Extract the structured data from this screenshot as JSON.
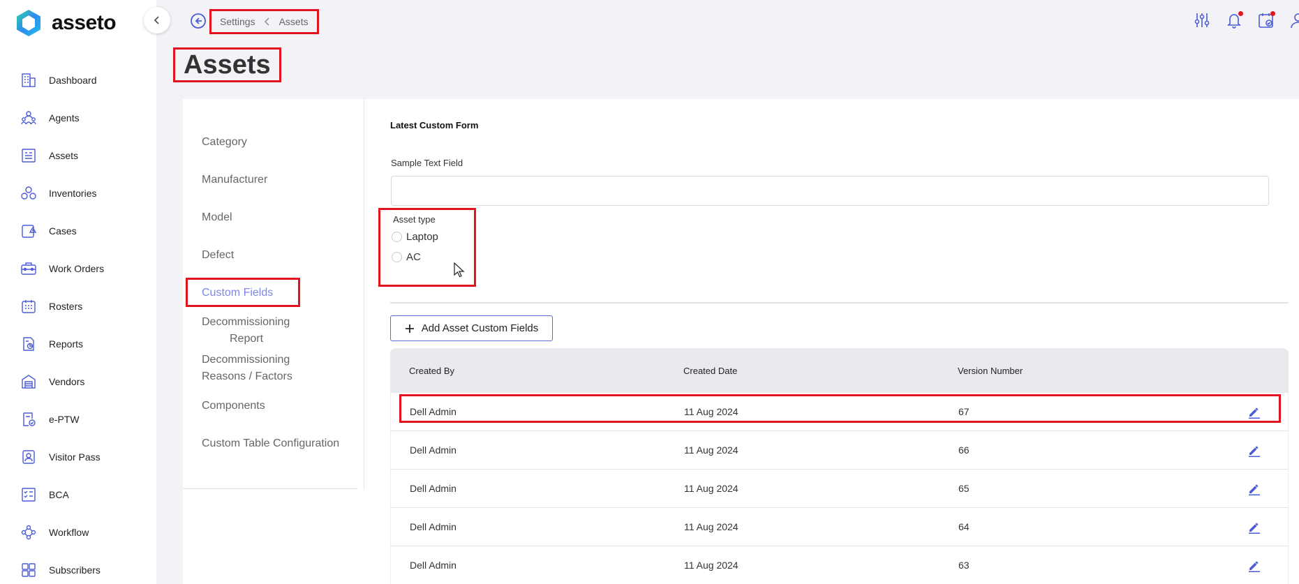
{
  "app": {
    "name": "asseto"
  },
  "breadcrumb": {
    "parent": "Settings",
    "current": "Assets"
  },
  "page": {
    "title": "Assets"
  },
  "sidebar": {
    "items": [
      {
        "label": "Dashboard",
        "icon": "dashboard-icon"
      },
      {
        "label": "Agents",
        "icon": "agents-icon"
      },
      {
        "label": "Assets",
        "icon": "assets-icon"
      },
      {
        "label": "Inventories",
        "icon": "inventories-icon"
      },
      {
        "label": "Cases",
        "icon": "cases-icon"
      },
      {
        "label": "Work Orders",
        "icon": "work-orders-icon"
      },
      {
        "label": "Rosters",
        "icon": "rosters-icon"
      },
      {
        "label": "Reports",
        "icon": "reports-icon"
      },
      {
        "label": "Vendors",
        "icon": "vendors-icon"
      },
      {
        "label": "e-PTW",
        "icon": "eptw-icon"
      },
      {
        "label": "Visitor Pass",
        "icon": "visitor-pass-icon"
      },
      {
        "label": "BCA",
        "icon": "bca-icon"
      },
      {
        "label": "Workflow",
        "icon": "workflow-icon"
      },
      {
        "label": "Subscribers",
        "icon": "subscribers-icon"
      }
    ]
  },
  "settings_menu": {
    "items": [
      "Category",
      "Manufacturer",
      "Model",
      "Defect",
      "Custom Fields",
      "Decommissioning",
      "Report",
      "Decommissioning",
      "Reasons / Factors",
      "Components",
      "Custom Table Configuration"
    ],
    "active": "Custom Fields"
  },
  "form": {
    "title": "Latest Custom Form",
    "text_field_label": "Sample Text Field",
    "text_field_value": "",
    "radio_label": "Asset type",
    "radio_options": [
      "Laptop",
      "AC"
    ]
  },
  "add_button_label": "Add Asset Custom Fields",
  "table": {
    "headers": [
      "Created By",
      "Created Date",
      "Version Number"
    ],
    "rows": [
      [
        "Dell Admin",
        "11 Aug 2024",
        "67"
      ],
      [
        "Dell Admin",
        "11 Aug 2024",
        "66"
      ],
      [
        "Dell Admin",
        "11 Aug 2024",
        "65"
      ],
      [
        "Dell Admin",
        "11 Aug 2024",
        "64"
      ],
      [
        "Dell Admin",
        "11 Aug 2024",
        "63"
      ]
    ]
  },
  "colors": {
    "accent": "#5b6cdd",
    "highlight": "#e0131f",
    "active_menu": "#7c88e6"
  }
}
